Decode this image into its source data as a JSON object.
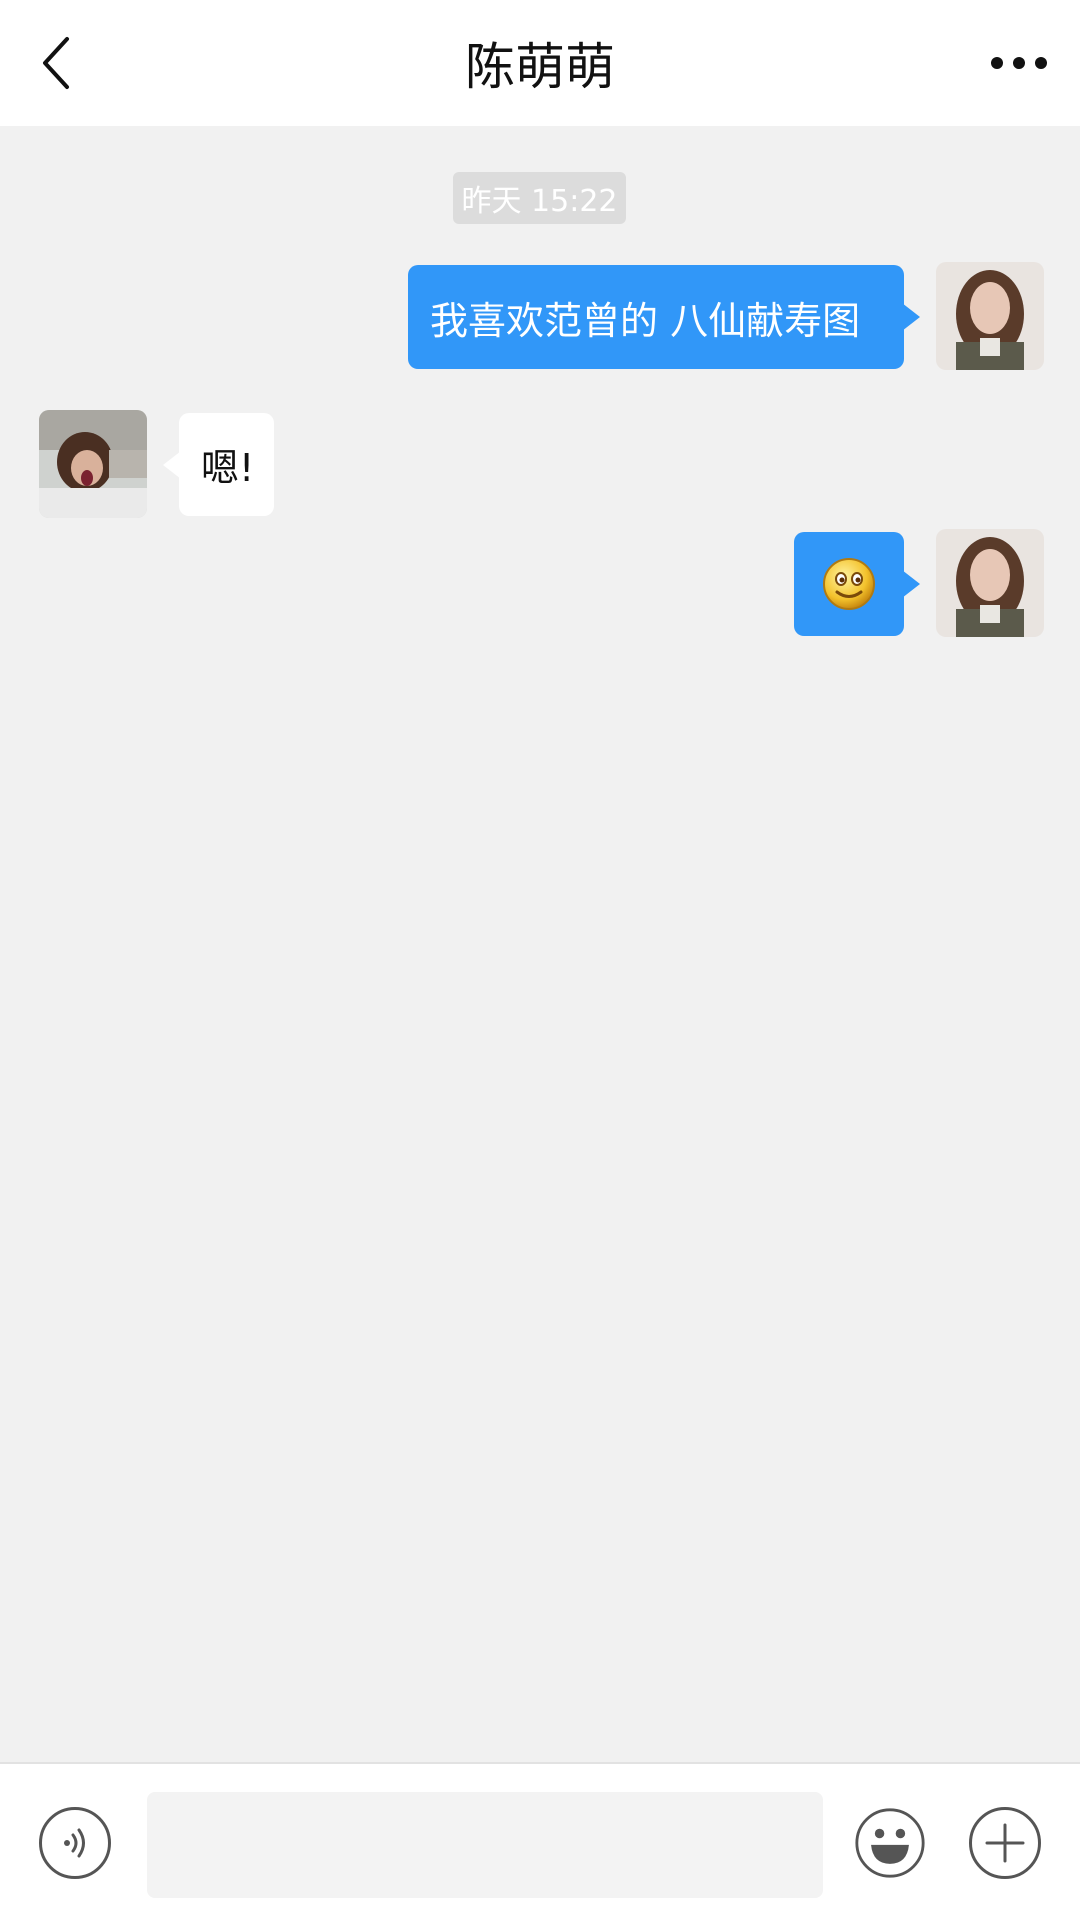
{
  "header": {
    "title": "陈萌萌",
    "back_icon": "chevron-left-icon",
    "more_icon": "more-horizontal-icon"
  },
  "messages": {
    "timestamp": "昨天  15:22",
    "items": [
      {
        "sender": "me",
        "type": "text",
        "text": "我喜欢范曾的 八仙献寿图"
      },
      {
        "sender": "them",
        "type": "text",
        "text": "嗯!"
      },
      {
        "sender": "me",
        "type": "emoji",
        "emoji": "smile-emoji"
      }
    ]
  },
  "footer": {
    "input_placeholder": "",
    "voice_icon": "voice-icon",
    "emoji_icon": "emoji-icon",
    "plus_icon": "plus-icon"
  },
  "colors": {
    "my_bubble": "#3197f8",
    "background": "#f1f1f1",
    "header": "#ffffff"
  }
}
